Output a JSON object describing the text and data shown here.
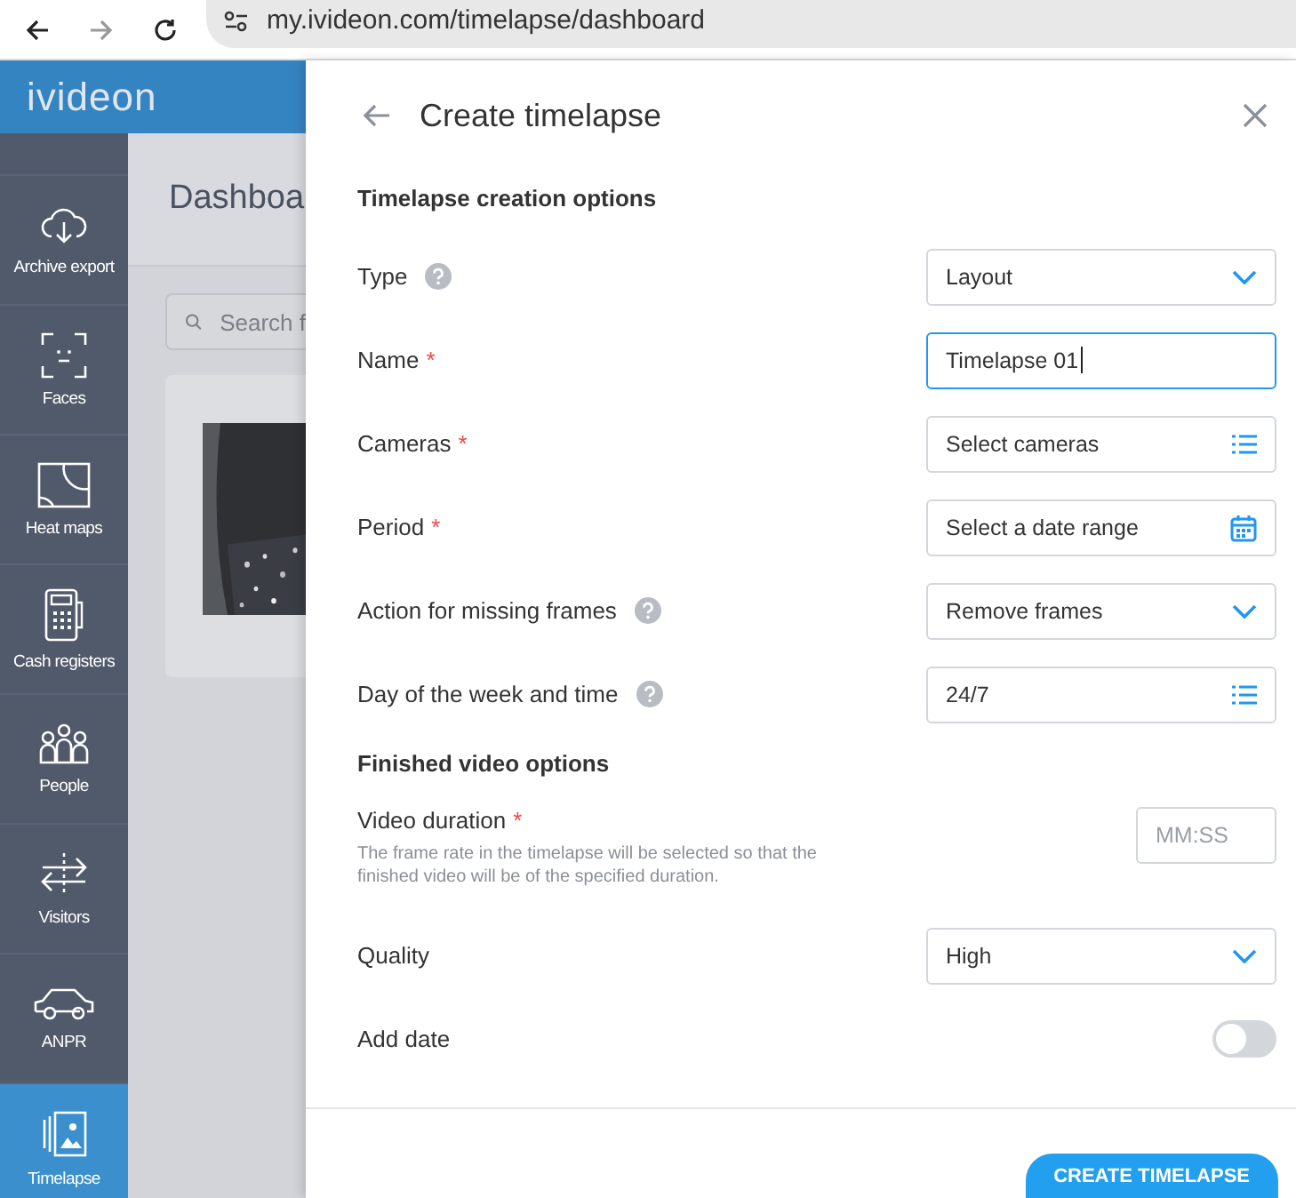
{
  "browser": {
    "url": "my.ivideon.com/timelapse/dashboard"
  },
  "header": {
    "logo": "ivideon"
  },
  "sidebar": {
    "items": [
      {
        "label": "Archive export",
        "selected": false
      },
      {
        "label": "Faces",
        "selected": false
      },
      {
        "label": "Heat maps",
        "selected": false
      },
      {
        "label": "Cash registers",
        "selected": false
      },
      {
        "label": "People",
        "selected": false
      },
      {
        "label": "Visitors",
        "selected": false
      },
      {
        "label": "ANPR",
        "selected": false
      },
      {
        "label": "Timelapse",
        "selected": true
      }
    ]
  },
  "main": {
    "title": "Dashboa",
    "search": {
      "placeholder": "Search f"
    }
  },
  "drawer": {
    "title": "Create timelapse",
    "sections": [
      {
        "title": "Timelapse creation options",
        "fields": [
          {
            "label": "Type",
            "help": true,
            "kind": "select",
            "value": "Layout"
          },
          {
            "label": "Name",
            "required_mark": "*",
            "kind": "input",
            "value": "Timelapse 01",
            "focused": true
          },
          {
            "label": "Cameras",
            "required_mark": "*",
            "kind": "list",
            "value": "Select cameras"
          },
          {
            "label": "Period",
            "required_mark": "*",
            "kind": "date",
            "value": "Select a date range"
          },
          {
            "label": "Action for missing frames",
            "help": true,
            "kind": "select",
            "value": "Remove frames"
          },
          {
            "label": "Day of the week and time",
            "help": true,
            "kind": "list",
            "value": "24/7"
          }
        ]
      },
      {
        "title": "Finished video options",
        "fields": [
          {
            "label": "Video duration",
            "required_mark": "*",
            "kind": "short",
            "placeholder": "MM:SS",
            "note": "The frame rate in the timelapse will be selected so that the finished video will be of the specified duration."
          },
          {
            "label": "Quality",
            "kind": "select",
            "value": "High"
          },
          {
            "label": "Add date",
            "kind": "toggle",
            "on": false
          }
        ]
      }
    ],
    "button": "CREATE TIMELAPSE"
  }
}
